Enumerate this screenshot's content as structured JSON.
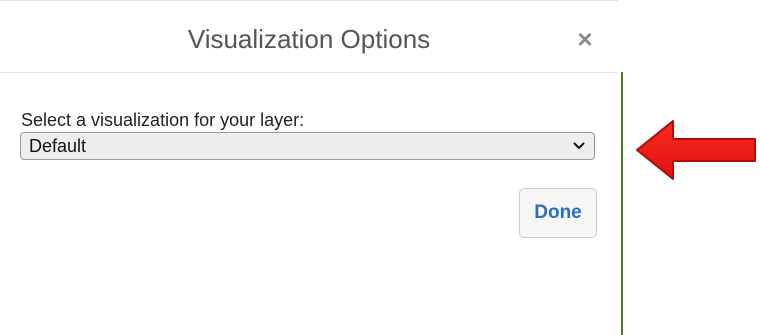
{
  "dialog": {
    "title": "Visualization Options",
    "close_label": "×",
    "field_label": "Select a visualization for your layer:",
    "select": {
      "value": "Default",
      "options": [
        "Default"
      ]
    },
    "done_label": "Done"
  },
  "annotation": {
    "icon": "red-arrow-left-icon",
    "color": "#e0201a"
  },
  "colors": {
    "accent": "#2a6fbf",
    "title_text": "#555555"
  }
}
